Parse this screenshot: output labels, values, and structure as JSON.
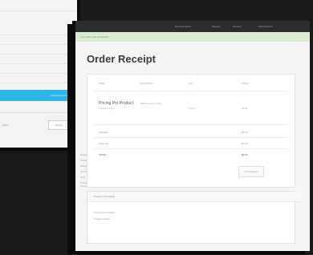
{
  "back_window": {
    "rows": [
      "",
      "",
      "",
      "",
      "",
      "",
      "",
      "",
      ""
    ],
    "action_label": "Subscribe Account",
    "back_link": "‹ Back",
    "cancel_label": "Cancel"
  },
  "front_window": {
    "topbar": {
      "nav": [
        "Documentation",
        "Support",
        "Account",
        "Subscriptions"
      ]
    },
    "notice": "Your order was successful.",
    "sidebar_items": [
      "Receipt",
      "Profile",
      "Billing",
      "Security",
      "Help",
      "Privacy Policy"
    ],
    "page_title": "Order Receipt",
    "table": {
      "headers": [
        "ITEM",
        "DURATION",
        "QTY",
        "PRICE"
      ],
      "product": {
        "name": "Pricing Pro Product",
        "sub": "Product Listing",
        "duration": "Billed once\nmonthly",
        "cycle": "1 Item",
        "price": "$0.00"
      },
      "summary": [
        {
          "label": "Subtotal",
          "value": "$0.00"
        },
        {
          "label": "Sales tax",
          "value": "$0.00"
        },
        {
          "label": "TOTAL",
          "value": "$0.00"
        }
      ],
      "print_label": "Print Receipt"
    },
    "info": {
      "heading": "Product Information",
      "lines": [
        "Pricing Pro Product",
        "Product Listing"
      ]
    }
  }
}
